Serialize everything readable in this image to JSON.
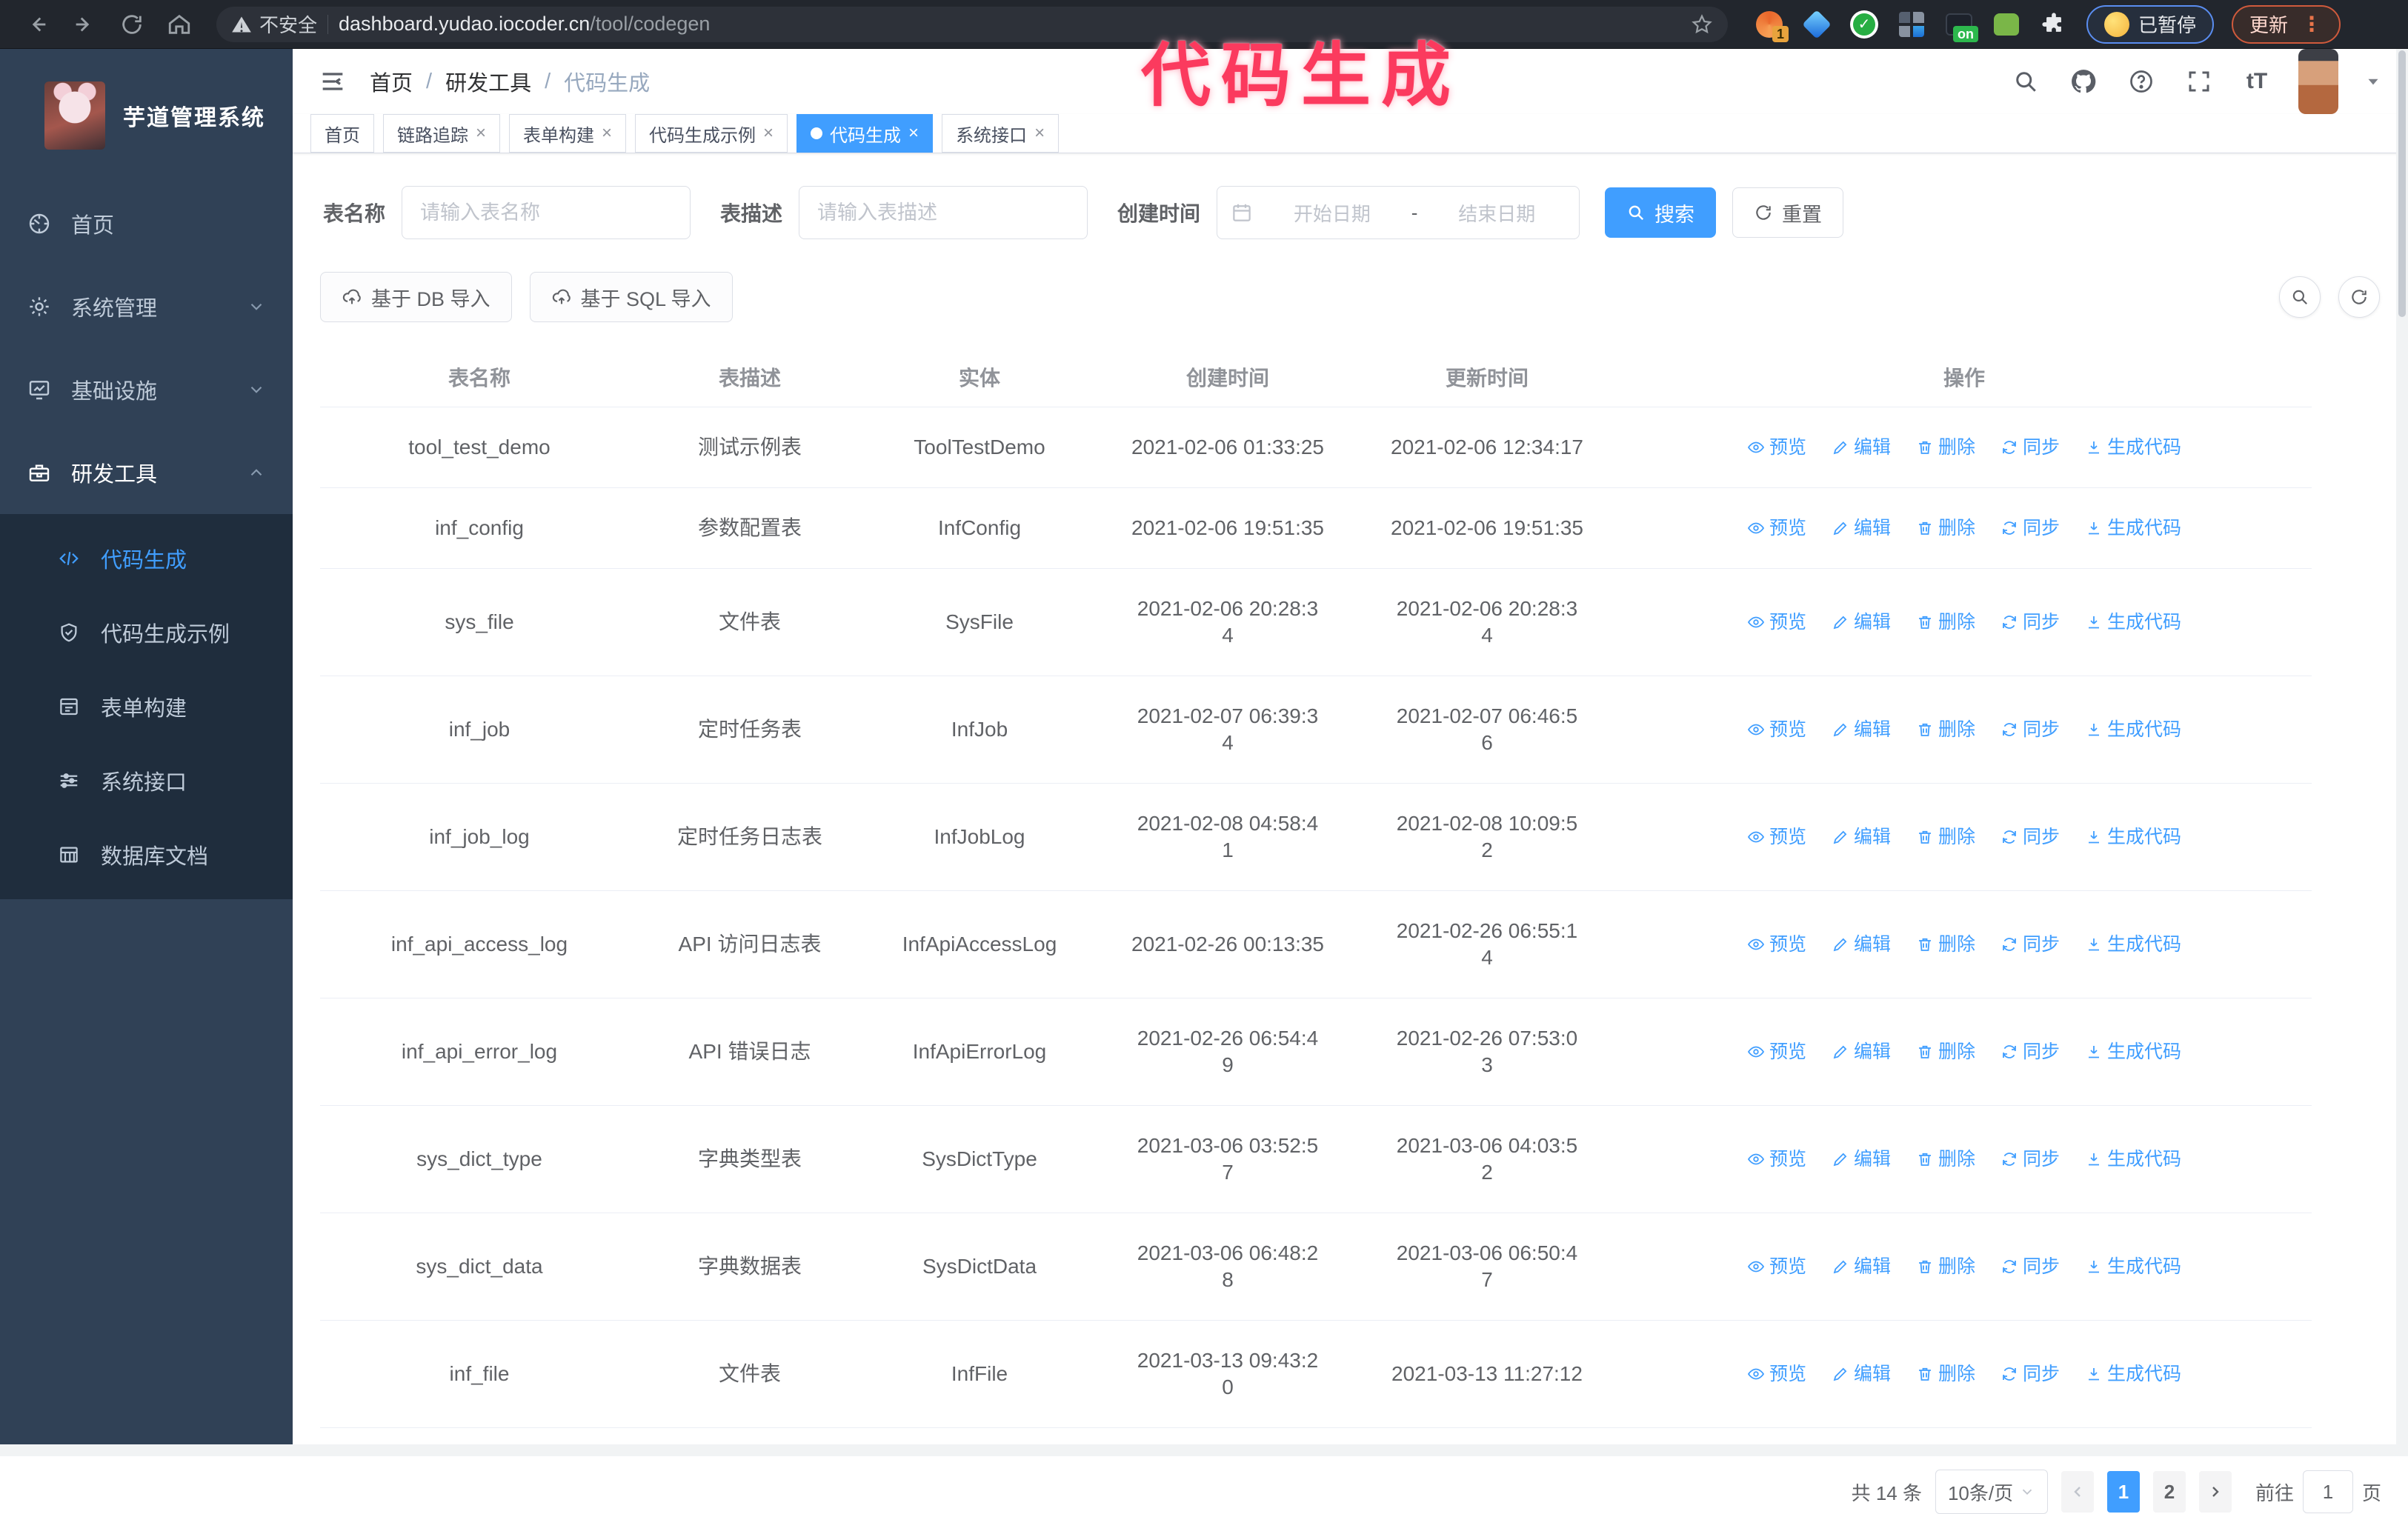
{
  "browser": {
    "security_label": "不安全",
    "url_domain": "dashboard.yudao.iocoder.cn",
    "url_path": "/tool/codegen",
    "extension_count_badge": "1",
    "extension_on_badge": "on",
    "paused_label": "已暂停",
    "update_label": "更新",
    "update_menu_dots": "⋮"
  },
  "annotation": {
    "text": "代码生成",
    "color": "#fb3a5e"
  },
  "sidebar": {
    "title": "芋道管理系统",
    "items": [
      {
        "label": "首页"
      },
      {
        "label": "系统管理"
      },
      {
        "label": "基础设施"
      },
      {
        "label": "研发工具"
      }
    ],
    "subitems": [
      {
        "label": "代码生成"
      },
      {
        "label": "代码生成示例"
      },
      {
        "label": "表单构建"
      },
      {
        "label": "系统接口"
      },
      {
        "label": "数据库文档"
      }
    ]
  },
  "header": {
    "breadcrumb": [
      "首页",
      "研发工具",
      "代码生成"
    ],
    "separator": "/"
  },
  "tabs": [
    {
      "label": "首页"
    },
    {
      "label": "链路追踪"
    },
    {
      "label": "表单构建"
    },
    {
      "label": "代码生成示例"
    },
    {
      "label": "代码生成"
    },
    {
      "label": "系统接口"
    }
  ],
  "filters": {
    "name_label": "表名称",
    "name_placeholder": "请输入表名称",
    "desc_label": "表描述",
    "desc_placeholder": "请输入表描述",
    "time_label": "创建时间",
    "start_placeholder": "开始日期",
    "range_separator": "-",
    "end_placeholder": "结束日期",
    "search_label": "搜索",
    "reset_label": "重置"
  },
  "toolbar": {
    "import_db_label": "基于 DB 导入",
    "import_sql_label": "基于 SQL 导入"
  },
  "table": {
    "columns": [
      "表名称",
      "表描述",
      "实体",
      "创建时间",
      "更新时间",
      "操作"
    ],
    "actions": [
      "预览",
      "编辑",
      "删除",
      "同步",
      "生成代码"
    ],
    "rows": [
      {
        "name": "tool_test_demo",
        "desc": "测试示例表",
        "entity": "ToolTestDemo",
        "created": "2021-02-06 01:33:25",
        "updated": "2021-02-06 12:34:17"
      },
      {
        "name": "inf_config",
        "desc": "参数配置表",
        "entity": "InfConfig",
        "created": "2021-02-06 19:51:35",
        "updated": "2021-02-06 19:51:35"
      },
      {
        "name": "sys_file",
        "desc": "文件表",
        "entity": "SysFile",
        "created": "2021-02-06 20:28:3\n4",
        "updated": "2021-02-06 20:28:3\n4"
      },
      {
        "name": "inf_job",
        "desc": "定时任务表",
        "entity": "InfJob",
        "created": "2021-02-07 06:39:3\n4",
        "updated": "2021-02-07 06:46:5\n6"
      },
      {
        "name": "inf_job_log",
        "desc": "定时任务日志表",
        "entity": "InfJobLog",
        "created": "2021-02-08 04:58:4\n1",
        "updated": "2021-02-08 10:09:5\n2"
      },
      {
        "name": "inf_api_access_log",
        "desc": "API 访问日志表",
        "entity": "InfApiAccessLog",
        "created": "2021-02-26 00:13:35",
        "updated": "2021-02-26 06:55:1\n4"
      },
      {
        "name": "inf_api_error_log",
        "desc": "API 错误日志",
        "entity": "InfApiErrorLog",
        "created": "2021-02-26 06:54:4\n9",
        "updated": "2021-02-26 07:53:0\n3"
      },
      {
        "name": "sys_dict_type",
        "desc": "字典类型表",
        "entity": "SysDictType",
        "created": "2021-03-06 03:52:5\n7",
        "updated": "2021-03-06 04:03:5\n2"
      },
      {
        "name": "sys_dict_data",
        "desc": "字典数据表",
        "entity": "SysDictData",
        "created": "2021-03-06 06:48:2\n8",
        "updated": "2021-03-06 06:50:4\n7"
      },
      {
        "name": "inf_file",
        "desc": "文件表",
        "entity": "InfFile",
        "created": "2021-03-13 09:43:2\n0",
        "updated": "2021-03-13 11:27:12"
      }
    ]
  },
  "pagination": {
    "total": "共 14 条",
    "page_size": "10条/页",
    "pages": [
      "1",
      "2"
    ],
    "goto_label": "前往",
    "goto_value": "1",
    "page_unit": "页"
  },
  "colors": {
    "accent": "#409eff",
    "sidebar_bg": "#304156",
    "submenu_bg": "#1f2d3d"
  }
}
